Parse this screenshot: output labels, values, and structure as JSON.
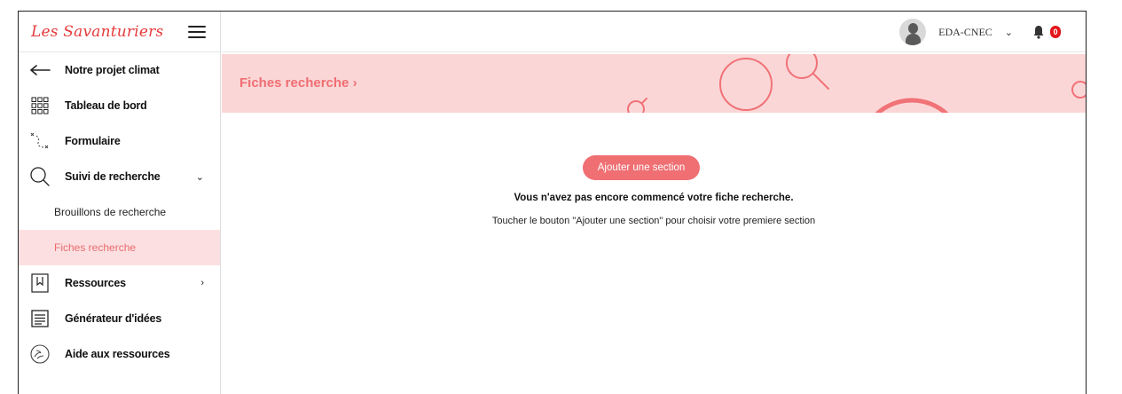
{
  "brand": {
    "logo_text": "Les Savanturiers",
    "menu_icon": "hamburger-icon"
  },
  "sidebar": {
    "items": [
      {
        "label": "Notre projet climat",
        "icon": "arrow-left-icon"
      },
      {
        "label": "Tableau de bord",
        "icon": "grid-icon"
      },
      {
        "label": "Formulaire",
        "icon": "path-icon"
      },
      {
        "label": "Suivi de recherche",
        "icon": "search-icon",
        "chevron": "⌄"
      },
      {
        "label": "Ressources",
        "icon": "bookmark-icon",
        "chevron": "›"
      },
      {
        "label": "Générateur d'idées",
        "icon": "document-icon"
      },
      {
        "label": "Aide aux ressources",
        "icon": "hands-icon"
      }
    ],
    "subitems": [
      {
        "label": "Brouillons de recherche",
        "active": false
      },
      {
        "label": "Fiches recherche",
        "active": true
      }
    ]
  },
  "header": {
    "username": "EDA-CNEC",
    "notification_count": "0"
  },
  "banner": {
    "title": "Fiches recherche ›"
  },
  "main": {
    "add_button": "Ajouter une section",
    "empty_title": "Vous n'avez pas encore commencé votre fiche recherche.",
    "empty_hint": "Toucher le bouton \"Ajouter une section\" pour choisir votre premiere section"
  },
  "colors": {
    "accent": "#ef6f73",
    "banner_bg": "#fbd6d7",
    "active_bg": "#fce0e1",
    "badge": "#e3151a"
  }
}
